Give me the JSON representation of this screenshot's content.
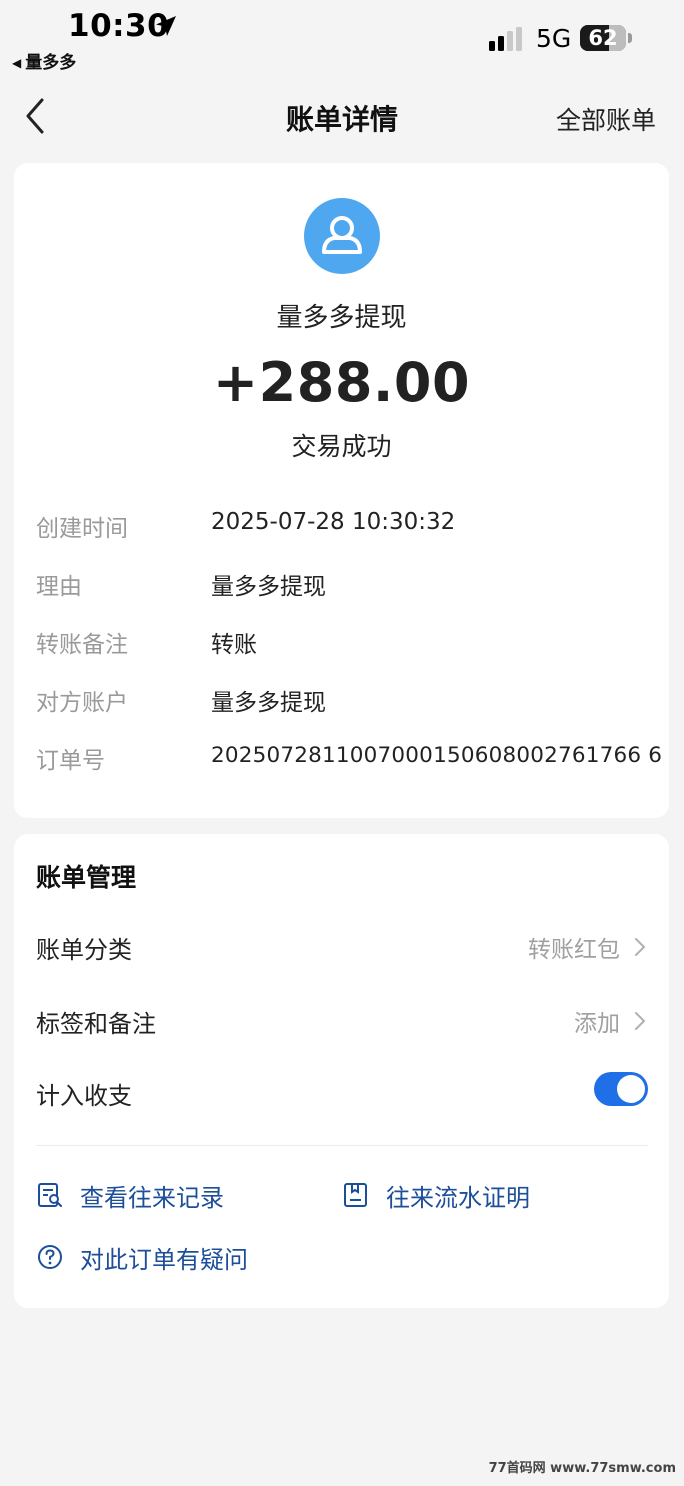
{
  "status_bar": {
    "time": "10:30",
    "back_app": "量多多",
    "network": "5G",
    "battery_level": "62",
    "battery_percent": 62
  },
  "nav": {
    "title": "账单详情",
    "right_link": "全部账单"
  },
  "transaction": {
    "payee": "量多多提现",
    "amount": "+288.00",
    "status": "交易成功"
  },
  "details": [
    {
      "key": "创建时间",
      "value": "2025-07-28 10:30:32"
    },
    {
      "key": "理由",
      "value": "量多多提现"
    },
    {
      "key": "转账备注",
      "value": "转账"
    },
    {
      "key": "对方账户",
      "value": "量多多提现"
    },
    {
      "key": "订单号",
      "value": "2025072811007000150608002761766 6"
    }
  ],
  "management": {
    "title": "账单管理",
    "category_label": "账单分类",
    "category_value": "转账红包",
    "tag_label": "标签和备注",
    "tag_value": "添加",
    "include_label": "计入收支",
    "include_enabled": true
  },
  "links": {
    "records": "查看往来记录",
    "proof": "往来流水证明",
    "question": "对此订单有疑问"
  },
  "watermark": "77首码网 www.77smw.com",
  "colors": {
    "accent": "#1f6fe6",
    "link": "#1d4e9a",
    "avatar": "#4ea7ef"
  }
}
